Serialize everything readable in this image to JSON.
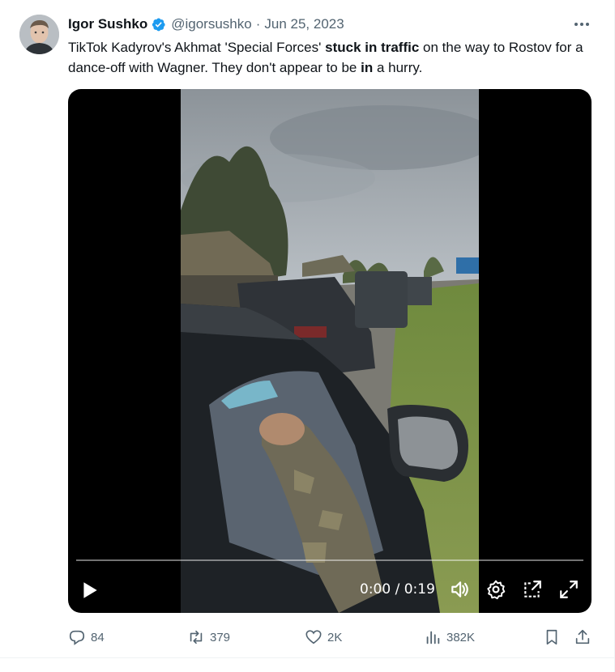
{
  "author": {
    "display_name": "Igor Sushko",
    "handle": "@igorsushko",
    "separator": "·",
    "date": "Jun 25, 2023",
    "verified_color": "#1d9bf0"
  },
  "tweet": {
    "text_parts": [
      {
        "text": "TikTok Kadyrov's Akhmat 'Special Forces' ",
        "bold": false
      },
      {
        "text": "stuck in traffic",
        "bold": true
      },
      {
        "text": " on the way to Rostov for a dance-off with Wagner. They don't appear to be ",
        "bold": false
      },
      {
        "text": "in",
        "bold": true
      },
      {
        "text": " a hurry.",
        "bold": false
      }
    ]
  },
  "video": {
    "time": "0:00 / 0:19",
    "progress": 0,
    "controls": [
      "play-icon",
      "volume-icon",
      "settings-icon",
      "popout-icon",
      "fullscreen-icon"
    ]
  },
  "actions": {
    "replies": "84",
    "reposts": "379",
    "likes": "2K",
    "views": "382K"
  },
  "colors": {
    "text_primary": "#0f1419",
    "text_secondary": "#536471",
    "accent": "#1d9bf0"
  }
}
